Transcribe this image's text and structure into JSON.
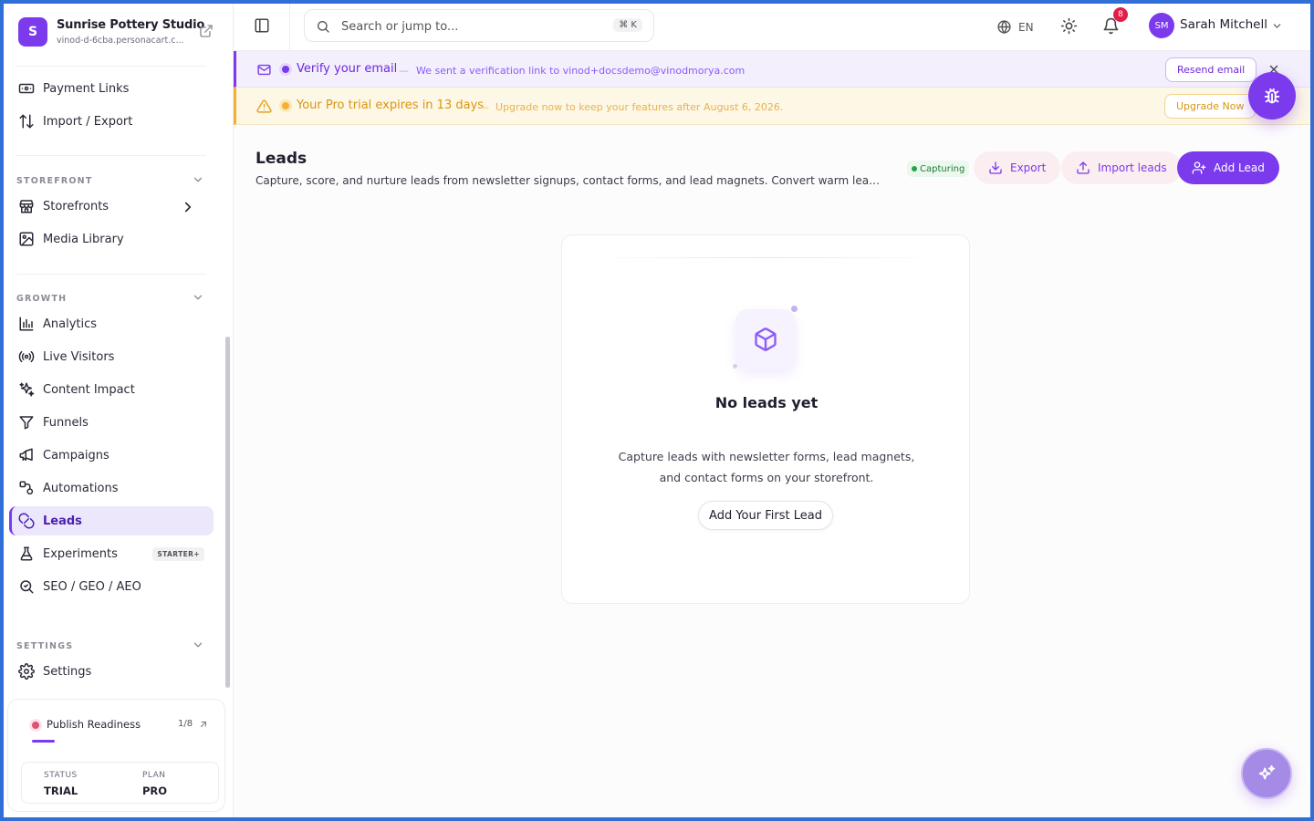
{
  "brand": {
    "initial": "S",
    "name": "Sunrise Pottery Studio",
    "domain": "vinod-d-6cba.personacart.c..."
  },
  "sidebar": {
    "top_items": [
      {
        "label": "Payment Links",
        "icon": "payment-link-icon"
      },
      {
        "label": "Import / Export",
        "icon": "import-export-icon"
      }
    ],
    "storefront": {
      "label": "STOREFRONT",
      "items": [
        {
          "label": "Storefronts",
          "icon": "store-icon"
        },
        {
          "label": "Media Library",
          "icon": "image-icon"
        }
      ]
    },
    "growth": {
      "label": "GROWTH",
      "items": [
        {
          "label": "Analytics",
          "icon": "bar-chart-icon"
        },
        {
          "label": "Live Visitors",
          "icon": "broadcast-icon"
        },
        {
          "label": "Content Impact",
          "icon": "sparkles-icon"
        },
        {
          "label": "Funnels",
          "icon": "funnel-icon"
        },
        {
          "label": "Campaigns",
          "icon": "megaphone-icon"
        },
        {
          "label": "Automations",
          "icon": "workflow-icon"
        },
        {
          "label": "Leads",
          "icon": "magnet-icon",
          "active": true
        },
        {
          "label": "Experiments",
          "icon": "flask-icon",
          "badge": "STARTER+"
        },
        {
          "label": "SEO / GEO / AEO",
          "icon": "search-zoom-icon"
        }
      ]
    },
    "settings": {
      "label": "SETTINGS",
      "items": [
        {
          "label": "Settings",
          "icon": "gear-icon"
        }
      ]
    },
    "readiness": {
      "label": "Publish Readiness",
      "count": "1/8",
      "progress": 0.125,
      "status_key": "STATUS",
      "status_value": "TRIAL",
      "plan_key": "PLAN",
      "plan_value": "PRO"
    }
  },
  "topbar": {
    "search_placeholder": "Search or jump to...",
    "shortcut": "⌘ K",
    "language": "EN",
    "notification_count": "8",
    "user_initials": "SM",
    "user_name": "Sarah Mitchell"
  },
  "banners": {
    "verify": {
      "title": "Verify your email",
      "separator": "—",
      "message": "We sent a verification link to vinod+docsdemo@vinodmorya.com",
      "button": "Resend email"
    },
    "trial": {
      "title": "Your Pro trial expires in 13 days",
      "separator": "—",
      "message": "Upgrade now to keep your features after August 6, 2026.",
      "button": "Upgrade Now"
    }
  },
  "page": {
    "title": "Leads",
    "description": "Capture, score, and nurture leads from newsletter signups, contact forms, and lead magnets. Convert warm leads into...",
    "status_pill": "Capturing",
    "export_label": "Export",
    "import_label": "Import leads",
    "add_label": "Add Lead"
  },
  "empty_state": {
    "title": "No leads yet",
    "description_line1": "Capture leads with newsletter forms, lead magnets,",
    "description_line2": "and contact forms on your storefront.",
    "button": "Add Your First Lead"
  },
  "colors": {
    "accent": "#7c3aed",
    "verify_bg": "#f3effd",
    "trial_bg": "#fdf7e6",
    "trial_accent": "#f2b134",
    "frame": "#2f6fd6"
  }
}
